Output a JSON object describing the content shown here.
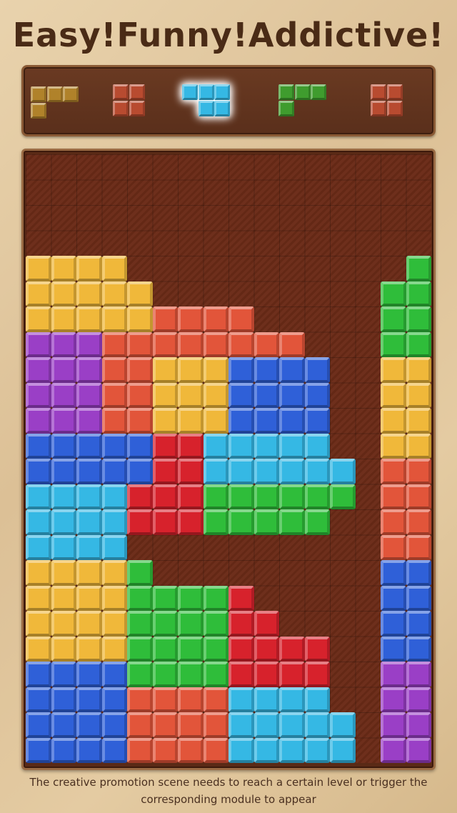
{
  "header": {
    "title": "Easy!Funny!Addictive!"
  },
  "footer": {
    "note": "The creative promotion scene needs to reach a certain level or trigger the corresponding module to appear"
  },
  "palette": {
    "Y": "#f0b83a",
    "O": "#e2553a",
    "R": "#d7222c",
    "P": "#9a3fc6",
    "B": "#2f60d8",
    "C": "#35b8e4",
    "G": "#2fbd3a",
    "T": "#b0822a",
    "K": "#b84b30",
    "L": "#3f9c2e"
  },
  "tray": {
    "pieces": [
      {
        "name": "tray-piece-l",
        "color": "T",
        "selected": false,
        "cells": [
          [
            0,
            0
          ],
          [
            1,
            0
          ],
          [
            2,
            0
          ],
          [
            0,
            1
          ]
        ]
      },
      {
        "name": "tray-piece-square",
        "color": "K",
        "selected": false,
        "cells": [
          [
            0,
            0
          ],
          [
            1,
            0
          ],
          [
            0,
            1
          ],
          [
            1,
            1
          ]
        ]
      },
      {
        "name": "tray-piece-cyan",
        "color": "C",
        "selected": true,
        "cells": [
          [
            0,
            0
          ],
          [
            1,
            0
          ],
          [
            2,
            0
          ],
          [
            1,
            1
          ],
          [
            2,
            1
          ]
        ]
      },
      {
        "name": "tray-piece-green-l",
        "color": "L",
        "selected": false,
        "cells": [
          [
            0,
            0
          ],
          [
            1,
            0
          ],
          [
            2,
            0
          ],
          [
            0,
            1
          ]
        ]
      },
      {
        "name": "tray-piece-square-2",
        "color": "K",
        "selected": false,
        "cells": [
          [
            0,
            0
          ],
          [
            1,
            0
          ],
          [
            0,
            1
          ],
          [
            1,
            1
          ]
        ]
      }
    ]
  },
  "board": {
    "cols": 16,
    "rows": 24,
    "grid": [
      "................",
      "................",
      "................",
      "................",
      "YYYY...........G",
      "YYYYY.........GG",
      "YYYYYOOOO.....GG",
      "PPPOOOOOOOO...GG",
      "PPPOOYYYBBBB..YY",
      "PPPOOYYYBBBB..YY",
      "PPPOOYYYBBBB..YY",
      "BBBBBRRCCCCC..YY",
      "BBBBBRRCCCCCC.OO",
      "CCCCRRRGGGGGG.OO",
      "CCCCRRRGGGGG..OO",
      "CCCC..........OO",
      "YYYYG.........BB",
      "YYYYGGGGR.....BB",
      "YYYYGGGGRR....BB",
      "YYYYGGGGRRRR..BB",
      "BBBBGGGGRRRR..PP",
      "BBBBOOOOCCCC..PP",
      "BBBBOOOOCCCCC.PP",
      "BBBBOOOOCCCCC.PP"
    ]
  }
}
